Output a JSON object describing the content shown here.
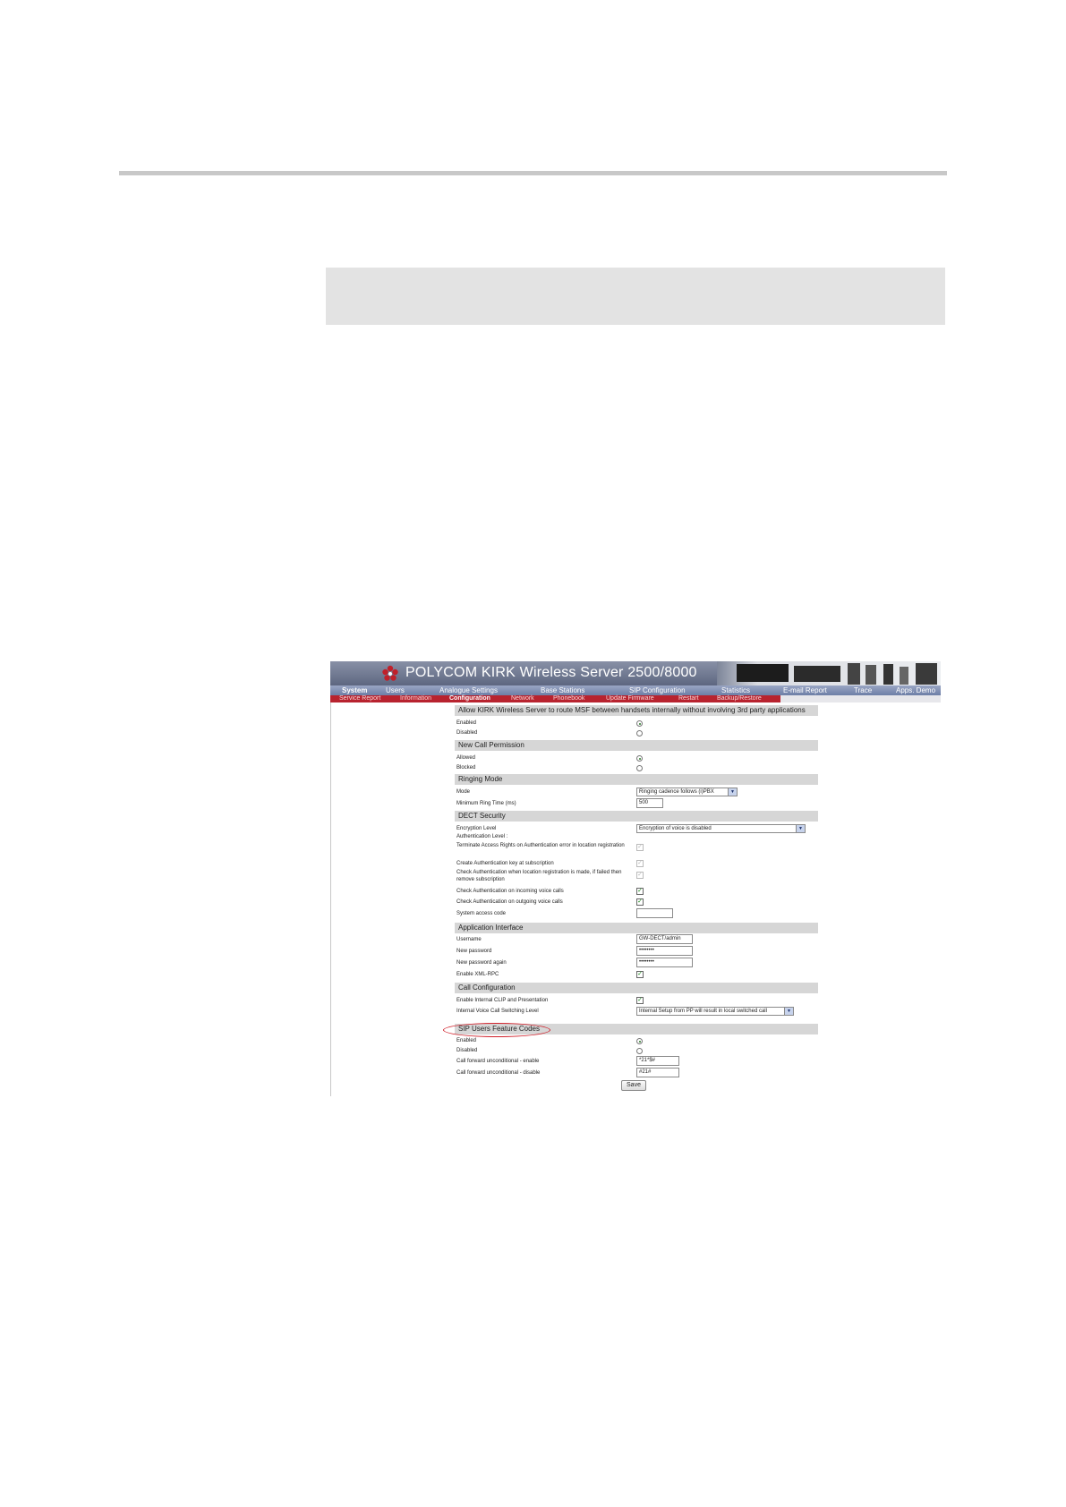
{
  "page": {
    "accent_colors": {
      "rule": "#c8c8c8",
      "box": "#e3e3e3",
      "annotation": "#d0202a"
    }
  },
  "app": {
    "title": "POLYCOM KIRK Wireless Server 2500/8000",
    "nav_main": [
      "System",
      "Users",
      "Analogue Settings",
      "Base Stations",
      "SIP Configuration",
      "Statistics",
      "E-mail Report",
      "Trace",
      "Apps. Demo"
    ],
    "nav_sub": [
      "Service Report",
      "Information",
      "Configuration",
      "Network",
      "Phonebook",
      "Update Firmware",
      "Restart",
      "Backup/Restore"
    ],
    "active_main": "System",
    "active_sub": "Configuration"
  },
  "form": {
    "msf": {
      "header": "Allow KIRK Wireless Server to route MSF between handsets internally without involving 3rd party applications",
      "enabled": "Enabled",
      "disabled": "Disabled",
      "selected": "Enabled"
    },
    "new_call_permission": {
      "header": "New Call Permission",
      "allowed": "Allowed",
      "blocked": "Blocked",
      "selected": "Allowed"
    },
    "ringing_mode": {
      "header": "Ringing Mode",
      "mode_label": "Mode",
      "mode_value": "Ringing cadence follows (i)PBX",
      "min_ring_label": "Minimum Ring Time (ms)",
      "min_ring_value": "500"
    },
    "dect_security": {
      "header": "DECT Security",
      "encryption_label": "Encryption Level",
      "encryption_value": "Encryption of voice is disabled",
      "auth_level_label": "Authentication Level :",
      "terminate_label": "Terminate Access Rights on Authentication error in location registration",
      "create_key_label": "Create Authentication key at subscription",
      "check_location_label": "Check Authentication when location registration is made, if failed then remove subscription",
      "check_incoming_label": "Check Authentication on incoming voice calls",
      "check_outgoing_label": "Check Authentication on outgoing voice calls",
      "access_code_label": "System access code",
      "access_code_value": ""
    },
    "application_interface": {
      "header": "Application Interface",
      "username_label": "Username",
      "username_value": "GW-DECT/admin",
      "new_password_label": "New password",
      "new_password_value": "••••••••",
      "new_password_again_label": "New password again",
      "new_password_again_value": "••••••••",
      "enable_xml_label": "Enable XML-RPC"
    },
    "call_configuration": {
      "header": "Call Configuration",
      "clip_label": "Enable Internal CLIP and Presentation",
      "switching_label": "Internal Voice Call Switching Level",
      "switching_value": "Internal Setup from PP will result in local switched call"
    },
    "sip_feature_codes": {
      "header": "SIP Users Feature Codes",
      "enabled": "Enabled",
      "disabled": "Disabled",
      "selected": "Enabled",
      "cfu_enable_label": "Call forward unconditional - enable",
      "cfu_enable_value": "*21*$#",
      "cfu_disable_label": "Call forward unconditional - disable",
      "cfu_disable_value": "#21#"
    },
    "save_label": "Save"
  }
}
